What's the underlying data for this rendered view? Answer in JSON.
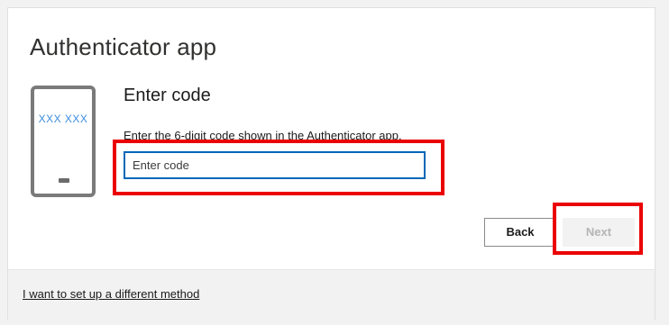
{
  "page": {
    "title": "Authenticator app"
  },
  "phone_illustration": {
    "code_text": "XXX XXX",
    "icon": "phone-icon"
  },
  "code_entry": {
    "heading": "Enter code",
    "instruction": "Enter the 6-digit code shown in the Authenticator app.",
    "input_value": "",
    "input_placeholder": "Enter code"
  },
  "actions": {
    "back_label": "Back",
    "next_label": "Next",
    "next_enabled": false
  },
  "footer": {
    "alt_method_link": "I want to set up a different method"
  },
  "colors": {
    "accent": "#0067b8",
    "highlight": "#ea0000",
    "disabled_text": "#b5b5b5",
    "phone_code": "#3c8dde"
  }
}
